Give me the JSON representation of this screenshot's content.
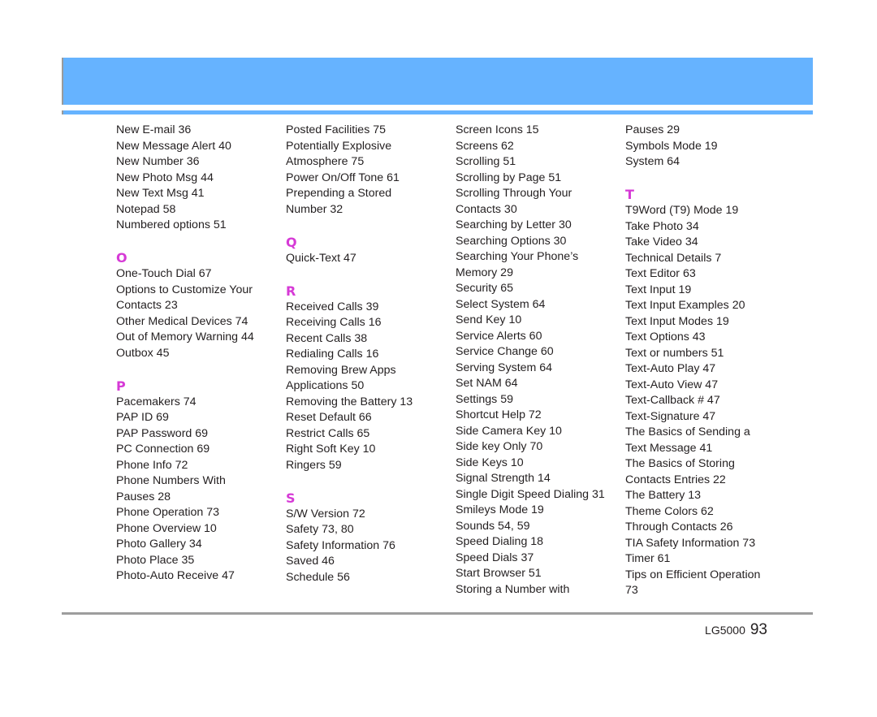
{
  "columns": [
    {
      "groups": [
        {
          "letter": "",
          "entries": [
            "New E-mail 36",
            "New Message Alert 40",
            "New Number 36",
            "New Photo Msg 44",
            "New Text Msg 41",
            "Notepad 58",
            "Numbered options 51"
          ]
        },
        {
          "letter": "O",
          "entries": [
            "One-Touch Dial 67",
            "Options to Customize Your",
            "Contacts 23",
            "Other Medical Devices 74",
            "Out of Memory Warning 44",
            "Outbox 45"
          ]
        },
        {
          "letter": "P",
          "entries": [
            "Pacemakers 74",
            "PAP ID 69",
            "PAP Password 69",
            "PC Connection 69",
            "Phone Info 72",
            "Phone Numbers With",
            "Pauses 28",
            "Phone Operation 73",
            "Phone Overview 10",
            "Photo Gallery 34",
            "Photo Place 35",
            "Photo-Auto Receive 47"
          ]
        }
      ]
    },
    {
      "groups": [
        {
          "letter": "",
          "entries": [
            "Posted Facilities 75",
            "Potentially Explosive",
            "Atmosphere 75",
            "Power On/Off Tone 61",
            "Prepending a Stored",
            "Number 32"
          ]
        },
        {
          "letter": "Q",
          "entries": [
            "Quick-Text 47"
          ]
        },
        {
          "letter": "R",
          "entries": [
            "Received Calls 39",
            "Receiving Calls 16",
            "Recent Calls 38",
            "Redialing Calls 16",
            "Removing Brew Apps",
            "Applications 50",
            "Removing the Battery 13",
            "Reset Default 66",
            "Restrict Calls 65",
            "Right Soft Key 10",
            "Ringers 59"
          ]
        },
        {
          "letter": "S",
          "entries": [
            "S/W Version 72",
            "Safety 73, 80",
            "Safety Information 76",
            "Saved 46",
            "Schedule 56"
          ]
        }
      ]
    },
    {
      "groups": [
        {
          "letter": "",
          "entries": [
            "Screen Icons 15",
            "Screens 62",
            "Scrolling 51",
            "Scrolling by Page 51",
            "Scrolling Through Your",
            "Contacts 30",
            "Searching by Letter 30",
            "Searching Options 30",
            "Searching Your Phone’s",
            "Memory 29",
            "Security 65",
            "Select System 64",
            "Send Key 10",
            "Service Alerts 60",
            "Service Change 60",
            "Serving System 64",
            "Set NAM 64",
            "Settings 59",
            "Shortcut Help 72",
            "Side Camera Key 10",
            "Side key Only 70",
            "Side Keys 10",
            "Signal Strength 14",
            "Single Digit Speed Dialing 31",
            "Smileys Mode 19",
            "Sounds 54, 59",
            "Speed Dialing 18",
            "Speed Dials 37",
            "Start Browser 51",
            "Storing a Number with"
          ]
        }
      ]
    },
    {
      "groups": [
        {
          "letter": "",
          "entries": [
            "Pauses 29",
            "Symbols Mode 19",
            "System 64"
          ]
        },
        {
          "letter": "T",
          "entries": [
            "T9Word (T9) Mode 19",
            "Take Photo 34",
            "Take Video 34",
            "Technical Details 7",
            "Text Editor 63",
            "Text Input 19",
            "Text Input Examples 20",
            "Text Input Modes 19",
            "Text Options 43",
            "Text or numbers 51",
            "Text-Auto Play 47",
            "Text-Auto View 47",
            "Text-Callback # 47",
            "Text-Signature 47",
            "The Basics of Sending a",
            "Text Message 41",
            "The Basics of Storing",
            "Contacts Entries 22",
            "The Battery 13",
            "Theme Colors 62",
            "Through Contacts 26",
            "TIA Safety Information 73",
            "Timer 61",
            "Tips on Efficient Operation",
            "73"
          ]
        }
      ]
    }
  ],
  "footer": {
    "model": "LG5000",
    "page_number": "93"
  },
  "colors": {
    "header_band": "#66b3ff",
    "letter_heading": "#d63ad6",
    "rule": "#9d9d9d"
  }
}
